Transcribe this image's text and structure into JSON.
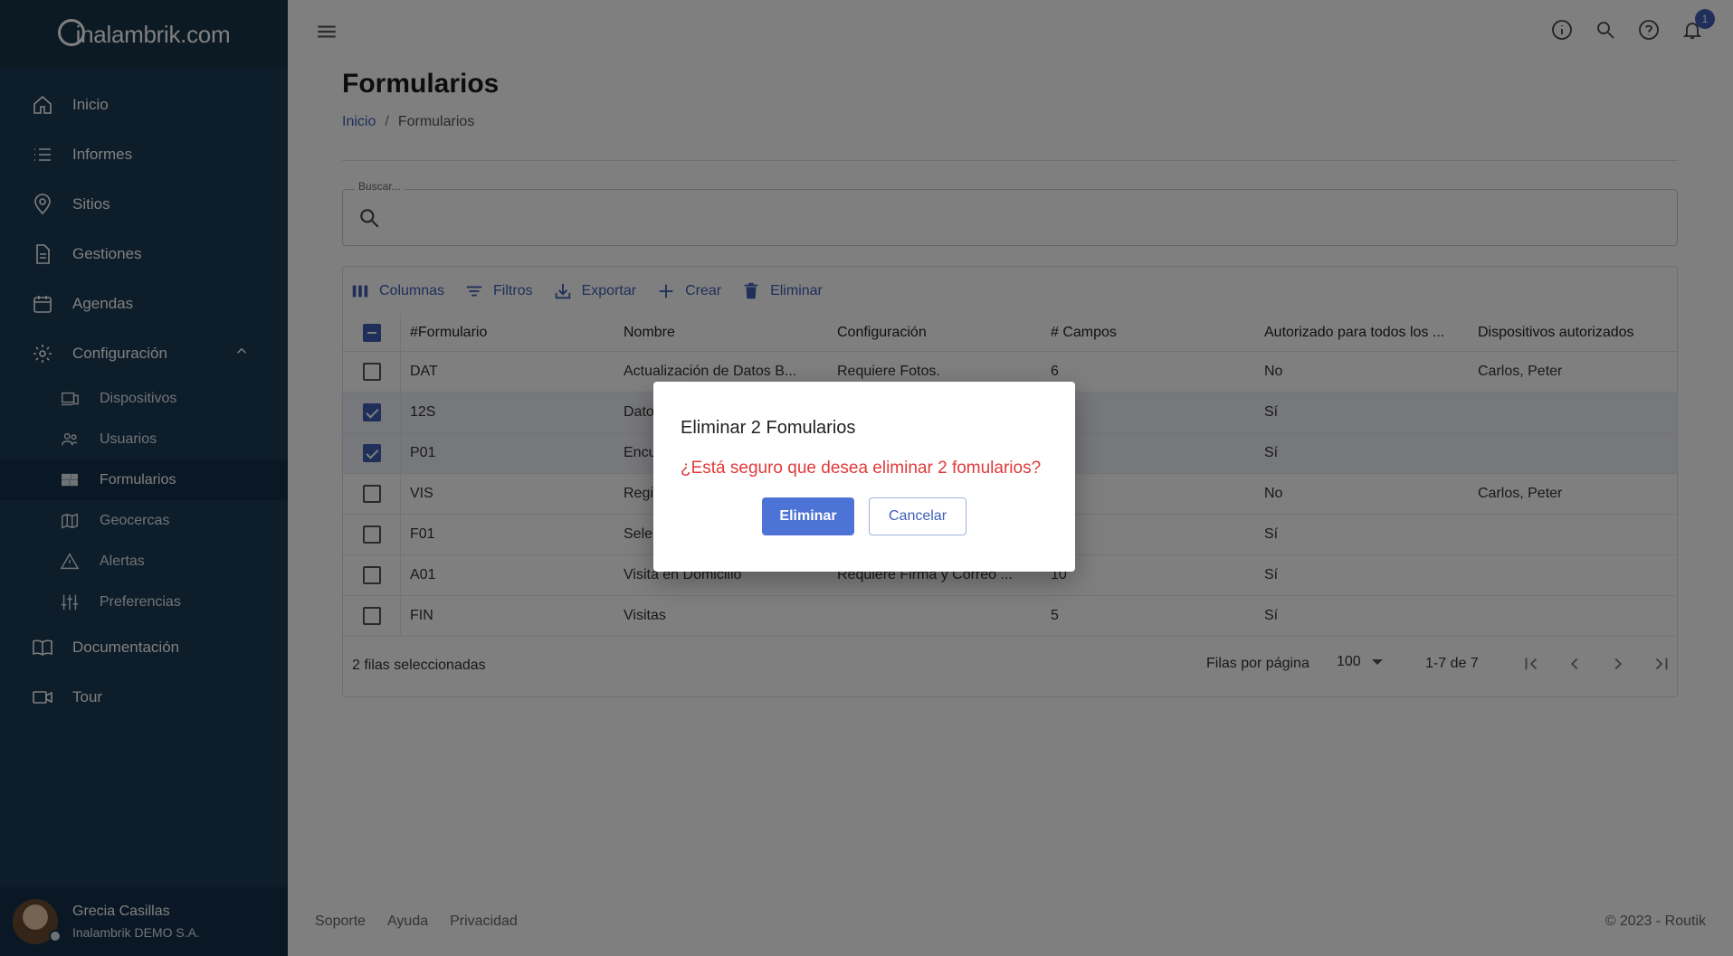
{
  "app": {
    "logo": "inalambrik.com",
    "colors": {
      "sidebar": "#1a3a52",
      "accent": "#3f5fb5",
      "danger": "#e03a3a"
    }
  },
  "sidebar": {
    "items": [
      {
        "label": "Inicio",
        "icon": "home-icon"
      },
      {
        "label": "Informes",
        "icon": "list-icon"
      },
      {
        "label": "Sitios",
        "icon": "location-icon"
      },
      {
        "label": "Gestiones",
        "icon": "document-icon"
      },
      {
        "label": "Agendas",
        "icon": "calendar-icon"
      },
      {
        "label": "Configuración",
        "icon": "gear-icon",
        "expanded": true
      }
    ],
    "sub_items": [
      {
        "label": "Dispositivos",
        "icon": "devices-icon"
      },
      {
        "label": "Usuarios",
        "icon": "users-icon"
      },
      {
        "label": "Formularios",
        "icon": "forms-icon",
        "active": true
      },
      {
        "label": "Geocercas",
        "icon": "map-icon"
      },
      {
        "label": "Alertas",
        "icon": "warning-icon"
      },
      {
        "label": "Preferencias",
        "icon": "sliders-icon"
      }
    ],
    "bottom_items": [
      {
        "label": "Documentación",
        "icon": "book-icon"
      },
      {
        "label": "Tour",
        "icon": "video-icon"
      }
    ],
    "user": {
      "name": "Grecia Casillas",
      "company": "Inalambrik DEMO S.A."
    }
  },
  "header": {
    "notifications": "1"
  },
  "page": {
    "title": "Formularios",
    "breadcrumb": {
      "home": "Inicio",
      "current": "Formularios"
    },
    "search": {
      "label": "Buscar..."
    }
  },
  "toolbar": {
    "columns": "Columnas",
    "filters": "Filtros",
    "export": "Exportar",
    "create": "Crear",
    "delete": "Eliminar"
  },
  "table": {
    "headers": [
      "#Formulario",
      "Nombre",
      "Configuración",
      "# Campos",
      "Autorizado para todos los ...",
      "Dispositivos autorizados"
    ],
    "rows": [
      {
        "id": "DAT",
        "name": "Actualización de Datos B...",
        "config": "Requiere Fotos.",
        "fields": "6",
        "all": "No",
        "devices": "Carlos, Peter",
        "checked": false
      },
      {
        "id": "12S",
        "name": "Dato",
        "config": "",
        "fields": "",
        "all": "Sí",
        "devices": "",
        "checked": true
      },
      {
        "id": "P01",
        "name": "Encu",
        "config": "",
        "fields": "",
        "all": "Sí",
        "devices": "",
        "checked": true
      },
      {
        "id": "VIS",
        "name": "Regi",
        "config": "",
        "fields": "",
        "all": "No",
        "devices": "Carlos, Peter",
        "checked": false
      },
      {
        "id": "F01",
        "name": "Sele",
        "config": "",
        "fields": "",
        "all": "Sí",
        "devices": "",
        "checked": false
      },
      {
        "id": "A01",
        "name": "Visita en Domicilio",
        "config": "Requiere Firma y Correo ...",
        "fields": "10",
        "all": "Sí",
        "devices": "",
        "checked": false
      },
      {
        "id": "FIN",
        "name": "Visitas",
        "config": "",
        "fields": "5",
        "all": "Sí",
        "devices": "",
        "checked": false
      }
    ]
  },
  "grid_footer": {
    "selected": "2 filas seleccionadas",
    "rows_per_page_label": "Filas por página",
    "rows_per_page": "100",
    "range": "1-7 de 7"
  },
  "footer": {
    "links": [
      "Soporte",
      "Ayuda",
      "Privacidad"
    ],
    "copyright": "© 2023 - Routik"
  },
  "dialog": {
    "title": "Eliminar 2 Fomularios",
    "message": "¿Está seguro que desea eliminar 2 fomularios?",
    "confirm": "Eliminar",
    "cancel": "Cancelar"
  }
}
